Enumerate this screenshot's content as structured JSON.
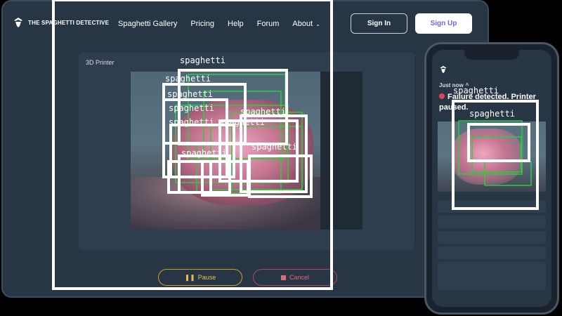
{
  "desktop": {
    "logo": "THE SPAGHETTI DETECTIVE",
    "nav": [
      "Spaghetti Gallery",
      "Pricing",
      "Help",
      "Forum",
      "About"
    ],
    "sign_in": "Sign In",
    "sign_up": "Sign Up",
    "card_title": "3D Printer",
    "pause": "Pause",
    "cancel": "Cancel"
  },
  "phone": {
    "time": "Just now",
    "alert": "Failure detected. Printer paused."
  },
  "detections": {
    "label": "spaghetti",
    "count": 14
  },
  "colors": {
    "brand_purple": "#7c5cf2",
    "pause_yellow": "#e6c24a",
    "cancel_red": "#e06a7c",
    "detect_green": "#2ecc40"
  }
}
